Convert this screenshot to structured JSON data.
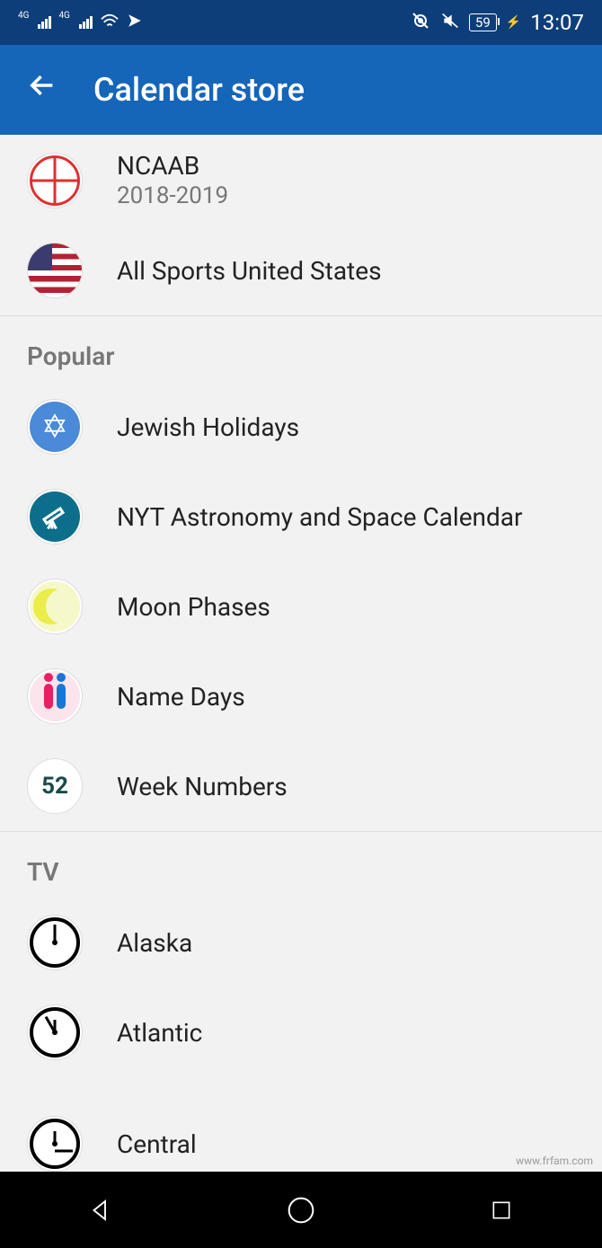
{
  "status": {
    "network_label": "4G",
    "battery": "59",
    "time": "13:07"
  },
  "header": {
    "title": "Calendar store"
  },
  "top_items": [
    {
      "title": "NCAAB",
      "subtitle": "2018-2019",
      "icon": "basketball"
    },
    {
      "title": "All Sports United States",
      "subtitle": "",
      "icon": "flag-us"
    }
  ],
  "sections": [
    {
      "header": "Popular",
      "items": [
        {
          "title": "Jewish Holidays",
          "icon": "star-david"
        },
        {
          "title": "NYT Astronomy and Space Calendar",
          "icon": "telescope"
        },
        {
          "title": "Moon Phases",
          "icon": "moon"
        },
        {
          "title": "Name Days",
          "icon": "nameday"
        },
        {
          "title": "Week Numbers",
          "icon": "weeknum",
          "icon_text": "52"
        }
      ]
    },
    {
      "header": "TV",
      "items": [
        {
          "title": "Alaska",
          "icon": "clock12"
        },
        {
          "title": "Atlantic",
          "icon": "clock11"
        },
        {
          "title": "Central",
          "icon": "clock3"
        }
      ]
    }
  ],
  "watermark": "www.frfam.com"
}
